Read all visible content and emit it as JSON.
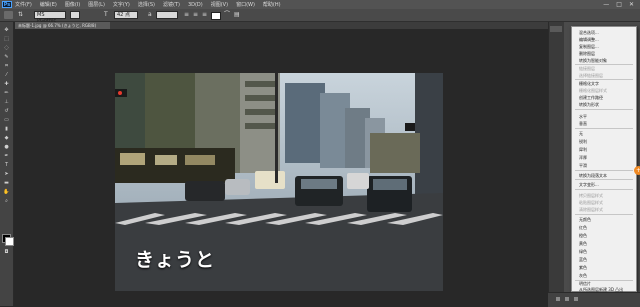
{
  "menubar": {
    "logo": "Ps",
    "items": [
      "文件(F)",
      "编辑(E)",
      "图像(I)",
      "图层(L)",
      "文字(Y)",
      "选择(S)",
      "滤镜(T)",
      "3D(D)",
      "视图(V)",
      "窗口(W)",
      "帮助(H)"
    ],
    "window_controls": [
      "—",
      "□",
      "✕"
    ]
  },
  "options": {
    "font_family": "MS PGothic",
    "font_style": "",
    "font_size": "42 点"
  },
  "document": {
    "tab_label": "未标题-1.jpg @ 66.7% (きょうと, RGB/8)"
  },
  "photo": {
    "caption": "きょうと"
  },
  "context_menu": {
    "items": [
      {
        "label": "混合选项...",
        "disabled": false
      },
      {
        "label": "编辑调整...",
        "disabled": false
      },
      {
        "label": "复制图层...",
        "disabled": false
      },
      {
        "label": "删除图层",
        "disabled": false
      },
      {
        "label": "转换为智能对象",
        "disabled": false
      },
      {
        "label": "链接图层",
        "disabled": true
      },
      {
        "label": "选择链接图层",
        "disabled": true
      },
      {
        "label": "栅格化文字",
        "disabled": false
      },
      {
        "label": "栅格化图层样式",
        "disabled": true
      },
      {
        "label": "创建工作路径",
        "disabled": false
      },
      {
        "label": "转换为形状",
        "disabled": false
      },
      {
        "label": "水平",
        "disabled": false
      },
      {
        "label": "垂直",
        "disabled": false
      },
      {
        "label": "无",
        "disabled": false
      },
      {
        "label": "锐利",
        "disabled": false
      },
      {
        "label": "犀利",
        "disabled": false
      },
      {
        "label": "浑厚",
        "disabled": false
      },
      {
        "label": "平滑",
        "disabled": false
      },
      {
        "label": "转换为段落文本",
        "disabled": false
      },
      {
        "label": "文字变形...",
        "disabled": false
      },
      {
        "label": "拷贝图层样式",
        "disabled": true
      },
      {
        "label": "粘贴图层样式",
        "disabled": true
      },
      {
        "label": "清除图层样式",
        "disabled": true
      },
      {
        "label": "无颜色",
        "disabled": false
      },
      {
        "label": "红色",
        "disabled": false
      },
      {
        "label": "橙色",
        "disabled": false
      },
      {
        "label": "黄色",
        "disabled": false
      },
      {
        "label": "绿色",
        "disabled": false
      },
      {
        "label": "蓝色",
        "disabled": false
      },
      {
        "label": "紫色",
        "disabled": false
      },
      {
        "label": "灰色",
        "disabled": false
      },
      {
        "label": "明信片",
        "disabled": false
      },
      {
        "label": "从所选图层新建 3D 凸出",
        "disabled": false
      }
    ]
  },
  "colors": {
    "accent": "#f08a24",
    "menu_bg": "#f0f0f0"
  }
}
